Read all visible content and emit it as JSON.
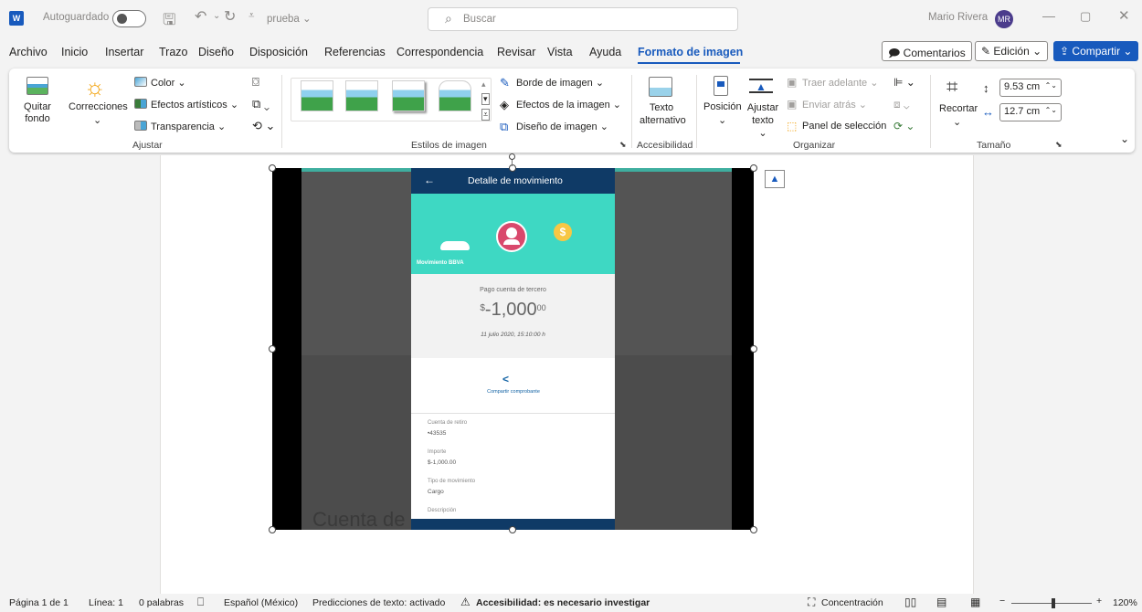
{
  "titlebar": {
    "logo": "W",
    "autosave_label": "Autoguardado",
    "doc_name": "prueba",
    "search_placeholder": "Buscar",
    "user_name": "Mario Rivera",
    "user_initials": "MR"
  },
  "menu": {
    "items": [
      "Archivo",
      "Inicio",
      "Insertar",
      "Trazo",
      "Diseño",
      "Disposición",
      "Referencias",
      "Correspondencia",
      "Revisar",
      "Vista",
      "Ayuda",
      "Formato de imagen"
    ],
    "active": "Formato de imagen",
    "comments_label": "Comentarios",
    "edit_label": "Edición",
    "share_label": "Compartir"
  },
  "ribbon": {
    "adjust": {
      "remove_bg": "Quitar fondo",
      "corrections": "Correcciones",
      "color": "Color",
      "artistic": "Efectos artísticos",
      "transparency": "Transparencia",
      "group": "Ajustar"
    },
    "styles": {
      "border": "Borde de imagen",
      "effects": "Efectos de la imagen",
      "layout": "Diseño de imagen",
      "group": "Estilos de imagen"
    },
    "accessibility": {
      "alt_text": "Texto alternativo",
      "group": "Accesibilidad"
    },
    "arrange": {
      "position": "Posición",
      "wrap_text": "Ajustar texto",
      "bring_forward": "Traer adelante",
      "send_backward": "Enviar atrás",
      "selection_pane": "Panel de selección",
      "group": "Organizar"
    },
    "size": {
      "crop": "Recortar",
      "height": "9.53 cm",
      "width": "12.7 cm",
      "group": "Tamaño"
    }
  },
  "phone": {
    "header": "Detalle de movimiento",
    "bank_label": "Movimiento BBVA",
    "subtitle": "Pago cuenta de tercero",
    "currency": "$",
    "amount": "-1,000",
    "cents": "00",
    "date": "11 julio 2020, 15:10:00 h",
    "share_label": "Compartir comprobante",
    "fields": [
      {
        "label": "Cuenta de retiro",
        "value": "•43535"
      },
      {
        "label": "Importe",
        "value": "$-1,000.00"
      },
      {
        "label": "Tipo de movimiento",
        "value": "Cargo"
      },
      {
        "label": "Descripción",
        "value": ""
      }
    ],
    "bg_text": "Cuenta de re"
  },
  "status": {
    "page": "Página 1 de 1",
    "line": "Línea: 1",
    "words": "0 palabras",
    "language": "Español (México)",
    "predictions": "Predicciones de texto: activado",
    "accessibility": "Accesibilidad: es necesario investigar",
    "focus": "Concentración",
    "zoom": "120%"
  },
  "colors": {
    "accent": "#185abd",
    "phone_header": "#0f3a66",
    "phone_teal": "#3ed8c3",
    "avatar": "#4b3c8c"
  }
}
